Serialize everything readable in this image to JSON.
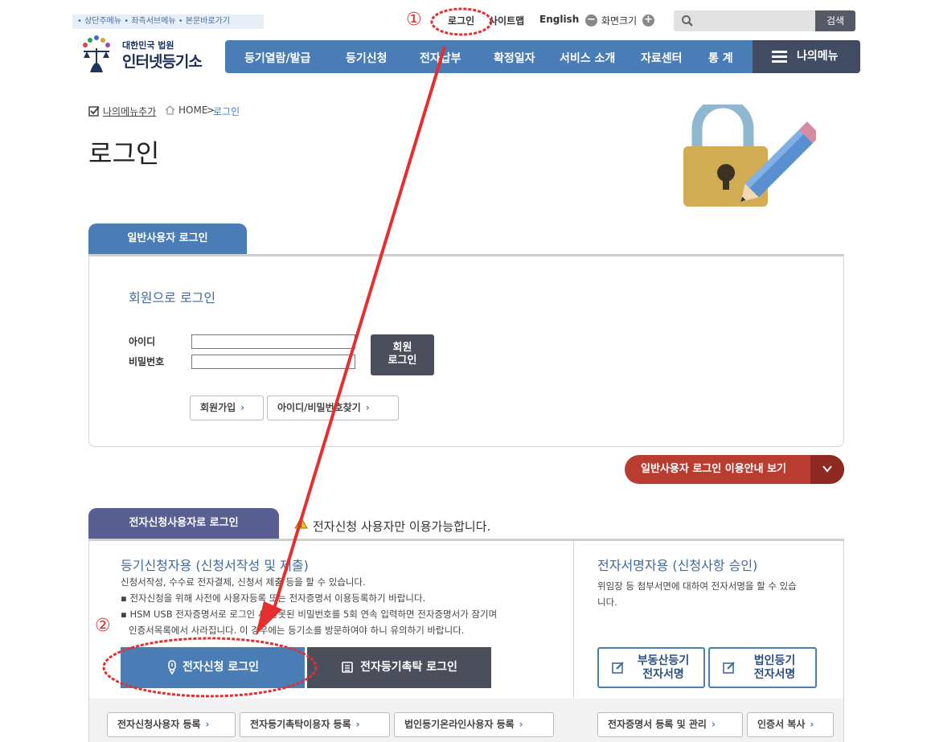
{
  "skip_links": "• 상단주메뉴 • 좌측서브메뉴 • 본문바로가기",
  "utility": {
    "login": "로그인",
    "sitemap": "사이트맵",
    "english": "English",
    "minus": "−",
    "font_size": "화면크기",
    "plus": "+",
    "search_label": "검색",
    "search_placeholder": ""
  },
  "logo": {
    "sub": "대한민국 법원",
    "main": "인터넷등기소"
  },
  "gnb": [
    "등기열람/발급",
    "등기신청",
    "전자납부",
    "확정일자",
    "서비스 소개",
    "자료센터",
    "통 계"
  ],
  "my_menu": "나의메뉴",
  "breadcrumb": {
    "add": "나의메뉴추가",
    "home": "HOME",
    "sep": ">",
    "current": "로그인"
  },
  "page_title": "로그인",
  "general": {
    "tab": "일반사용자 로그인",
    "title": "회원으로 로그인",
    "id_label": "아이디",
    "pw_label": "비밀번호",
    "id_value": "",
    "pw_value": "",
    "login_line1": "회원",
    "login_line2": "로그인",
    "join": "회원가입",
    "find": "아이디/비밀번호찾기",
    "guide": "일반사용자 로그인 이용안내 보기"
  },
  "electronic": {
    "tab": "전자신청사용자로 로그인",
    "notice": "전자신청 사용자만 이용가능합니다.",
    "left_title": "등기신청자용 (신청서작성 및 제출)",
    "desc": "신청서작성, 수수료 전자결제, 신청서 제출 등을 할 수 있습니다.",
    "bullet1": "▪ 전자신청을 위해 사전에 사용자등록 또는 전자증명서 이용등록하기 바랍니다.",
    "bullet2a": "▪ HSM USB 전자증명서로 로그인 시 잘못된 비밀번호를 5회 연속 입력하면 전자증명서가 잠기며",
    "bullet2b": "인증서목록에서 사라집니다. 이 경우에는 등기소를 방문하여야 하니 유의하기 바랍니다.",
    "btn_login": "전자신청 로그인",
    "btn_trust": "전자등기촉탁 로그인",
    "right_title": "전자서명자용 (신청사항 승인)",
    "right_desc1": "위임장 등 첨부서면에 대하여 전자서명을 할 수 있습",
    "right_desc2": "니다.",
    "sign_re_1": "부동산등기",
    "sign_re_2": "전자서명",
    "sign_corp_1": "법인등기",
    "sign_corp_2": "전자서명",
    "reg_user": "전자신청사용자 등록",
    "reg_trust": "전자등기촉탁이용자 등록",
    "reg_corp": "법인등기온라인사용자 등록",
    "cert_mgmt": "전자증명서 등록 및 관리",
    "cert_copy": "인증서 복사"
  },
  "annotations": {
    "step1": "①",
    "step2": "②"
  },
  "colors": {
    "nav_blue": "#4a7cb5",
    "dark": "#414c63",
    "red_accent": "#e62e2e",
    "guide_red": "#b83c30",
    "purple_tab": "#5a5f93"
  }
}
